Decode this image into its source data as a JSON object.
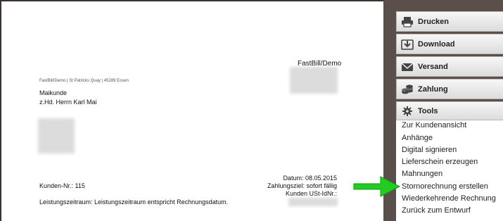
{
  "document": {
    "company": "FastBill/Demo",
    "sender_line": "FastBill/Demo | St Patricks Quay | 45289 Essen",
    "recipient_name": "Maikunde",
    "recipient_contact": "z.Hd. Herrn Karl Mai",
    "date": "Datum: 08.05.2015",
    "payment_term": "Zahlungsziel: sofort fällig",
    "vat_id": "Kunden USt-IdNr.:",
    "customer_no": "Kunden-Nr.: 115",
    "service_period": "Leistungszeitraum: Leistungszeitraum entspricht Rechnungsdatum."
  },
  "actions": [
    {
      "label": "Drucken",
      "icon": "printer-icon"
    },
    {
      "label": "Download",
      "icon": "download-icon"
    },
    {
      "label": "Versand",
      "icon": "envelope-icon"
    },
    {
      "label": "Zahlung",
      "icon": "coins-icon"
    }
  ],
  "tools": {
    "title": "Tools",
    "icon": "gear-icon",
    "items": [
      "Zur Kundenansicht",
      "Anhänge",
      "Digital signieren",
      "Lieferschein erzeugen",
      "Mahnungen",
      "Stornorechnung erstellen",
      "Wiederkehrende Rechnung",
      "Zurück zum Entwurf"
    ]
  },
  "colors": {
    "panel_bg": "#5b5049",
    "arrow": "#22cc22"
  }
}
